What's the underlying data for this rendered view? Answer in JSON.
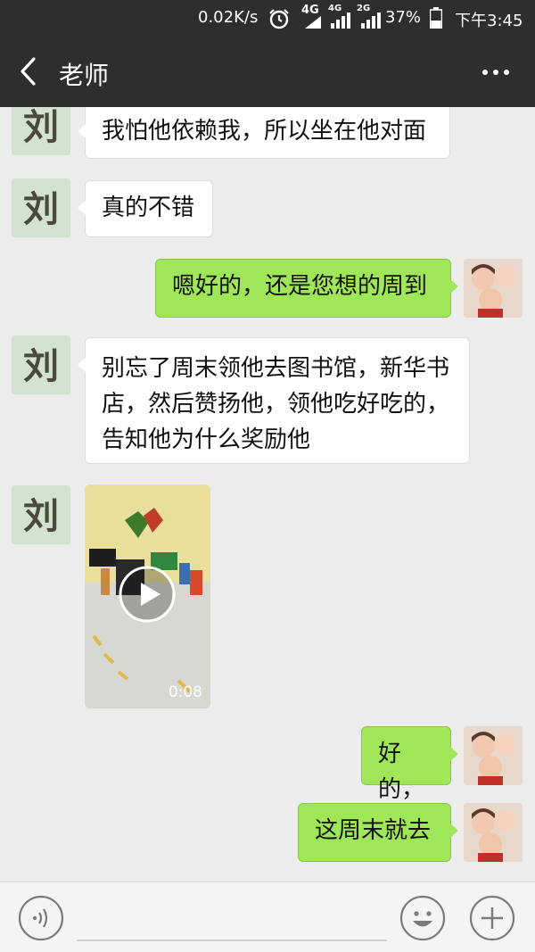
{
  "status_bar": {
    "net_speed": "0.02K/s",
    "alarm_icon": "alarm-clock-icon",
    "sim1_type": "4G",
    "sim2_type": "4G",
    "sim3_type": "2G",
    "battery": "37%",
    "time": "下午3:45"
  },
  "header": {
    "back_icon": "chevron-left-icon",
    "title": "老师",
    "more_icon": "more-dots-icon"
  },
  "messages": [
    {
      "side": "in",
      "text": "我怕他依赖我，所以坐在他对面"
    },
    {
      "side": "in",
      "text": "真的不错"
    },
    {
      "side": "out",
      "text": "嗯好的，还是您想的周到"
    },
    {
      "side": "in",
      "lines": [
        "别忘了周末领他去图书馆，新华书",
        "店，然后赞扬他，领他吃好吃的，",
        "告知他为什么奖励他"
      ]
    },
    {
      "side": "in",
      "type": "video",
      "duration": "0:08"
    },
    {
      "side": "out",
      "text": "好的，"
    },
    {
      "side": "out",
      "text": "这周末就去"
    }
  ],
  "input_bar": {
    "voice_icon": "voice-icon",
    "input_value": "",
    "emoji_icon": "emoji-icon",
    "plus_icon": "plus-icon"
  },
  "colors": {
    "header_bg": "#2e2e2e",
    "chat_bg": "#ececec",
    "bubble_out": "#9fe658",
    "bubble_in": "#ffffff"
  }
}
